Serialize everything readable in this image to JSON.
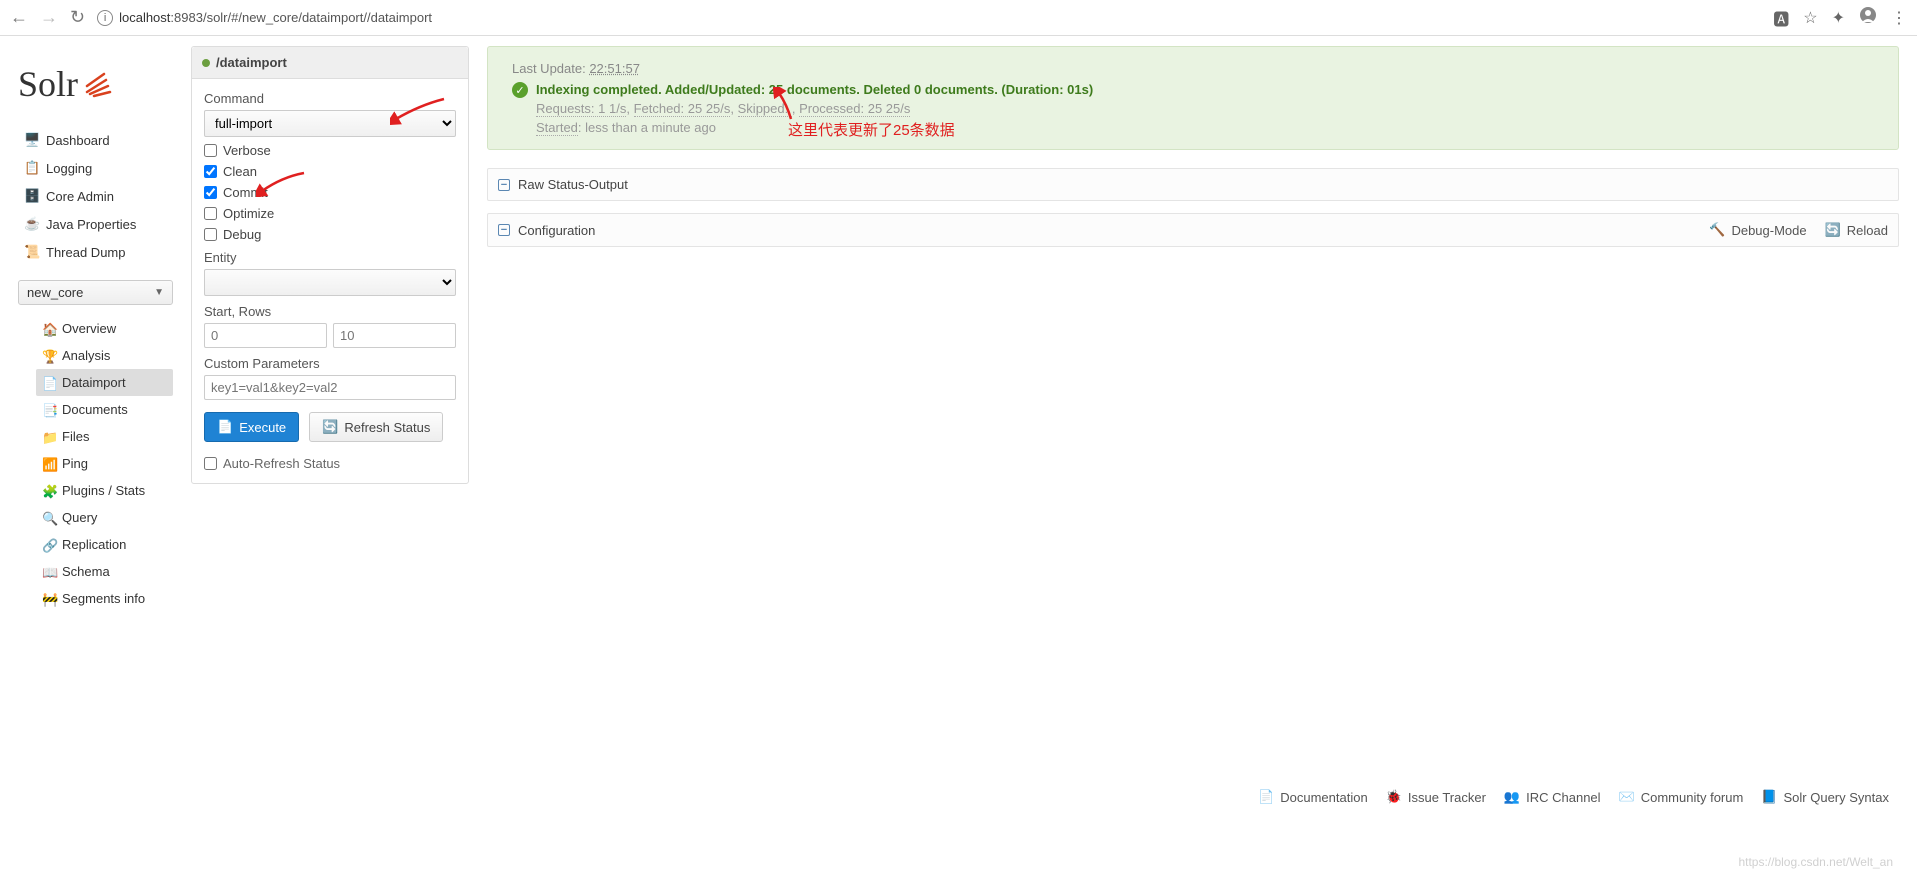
{
  "browser": {
    "url_host": "localhost",
    "url_port": ":8983",
    "url_path": "/solr/#/new_core/dataimport//dataimport"
  },
  "logo": "Solr",
  "nav": {
    "dashboard": "Dashboard",
    "logging": "Logging",
    "core_admin": "Core Admin",
    "java_props": "Java Properties",
    "thread_dump": "Thread Dump"
  },
  "core_selector": "new_core",
  "core_nav": {
    "overview": "Overview",
    "analysis": "Analysis",
    "dataimport": "Dataimport",
    "documents": "Documents",
    "files": "Files",
    "ping": "Ping",
    "plugins": "Plugins / Stats",
    "query": "Query",
    "replication": "Replication",
    "schema": "Schema",
    "segments": "Segments info"
  },
  "panel": {
    "title": "/dataimport",
    "command_label": "Command",
    "command_value": "full-import",
    "verbose": "Verbose",
    "clean": "Clean",
    "commit": "Commit",
    "optimize": "Optimize",
    "debug": "Debug",
    "entity_label": "Entity",
    "startrows_label": "Start, Rows",
    "start_placeholder": "0",
    "rows_placeholder": "10",
    "custom_label": "Custom Parameters",
    "custom_placeholder": "key1=val1&key2=val2",
    "execute": "Execute",
    "refresh": "Refresh Status",
    "auto": "Auto-Refresh Status"
  },
  "status": {
    "last_update_label": "Last Update: ",
    "last_update_time": "22:51:57",
    "message": "Indexing completed. Added/Updated: 25 documents. Deleted 0 documents. (Duration: 01s)",
    "detail_requests": "Requests: 1 1/s",
    "detail_fetched": "Fetched: 25 25/s",
    "detail_skipped": "Skipped: ",
    "detail_processed": "Processed: 25 25/s",
    "started_label": "Started",
    "started_value": ": less than a minute ago"
  },
  "annotation": "这里代表更新了25条数据",
  "sections": {
    "raw": "Raw Status-Output",
    "config": "Configuration",
    "debug_mode": "Debug-Mode",
    "reload": "Reload"
  },
  "footer": {
    "doc": "Documentation",
    "issue": "Issue Tracker",
    "irc": "IRC Channel",
    "forum": "Community forum",
    "syntax": "Solr Query Syntax"
  },
  "watermark": "https://blog.csdn.net/Welt_an"
}
